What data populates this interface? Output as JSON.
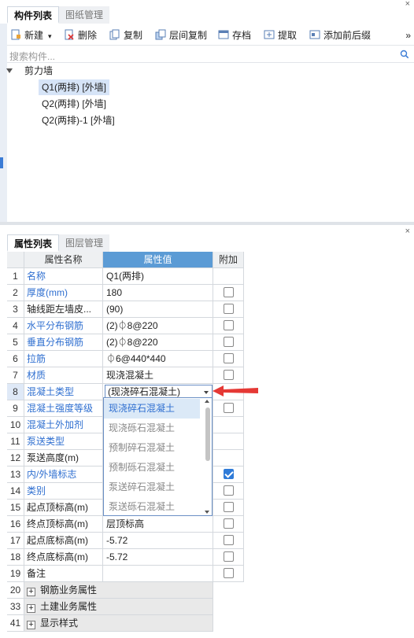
{
  "component_panel": {
    "tabs": [
      "构件列表",
      "图纸管理"
    ],
    "toolbar": [
      {
        "label": "新建",
        "icon": "new-icon"
      },
      {
        "label": "删除",
        "icon": "delete-icon"
      },
      {
        "label": "复制",
        "icon": "copy-icon"
      },
      {
        "label": "层间复制",
        "icon": "floor-copy-icon"
      },
      {
        "label": "存档",
        "icon": "archive-icon"
      },
      {
        "label": "提取",
        "icon": "extract-icon"
      },
      {
        "label": "添加前后缀",
        "icon": "add-prefix-suffix-icon"
      }
    ],
    "more": "»",
    "search_placeholder": "搜索构件...",
    "tree": {
      "root": "剪力墙",
      "items": [
        "Q1(两排) [外墙]",
        "Q2(两排) [外墙]",
        "Q2(两排)-1 [外墙]"
      ],
      "selected_index": 0
    }
  },
  "property_panel": {
    "tabs": [
      "属性列表",
      "图层管理"
    ],
    "headers": {
      "name": "属性名称",
      "value": "属性值",
      "add": "附加"
    },
    "rows": [
      {
        "idx": "1",
        "name": "名称",
        "value": "Q1(两排)",
        "checkbox": null
      },
      {
        "idx": "2",
        "name": "厚度(mm)",
        "value": "180",
        "checkbox": false
      },
      {
        "idx": "3",
        "name": "轴线距左墙皮...",
        "value": "(90)",
        "checkbox": false
      },
      {
        "idx": "4",
        "name": "水平分布钢筋",
        "value": "(2)⏀8@220",
        "checkbox": false
      },
      {
        "idx": "5",
        "name": "垂直分布钢筋",
        "value": "(2)⏀8@220",
        "checkbox": false
      },
      {
        "idx": "6",
        "name": "拉筋",
        "value": "⏀6@440*440",
        "checkbox": false
      },
      {
        "idx": "7",
        "name": "材质",
        "value": "现浇混凝土",
        "checkbox": false
      },
      {
        "idx": "8",
        "name": "混凝土类型",
        "value": "(现浇碎石混凝土)",
        "checkbox": null
      },
      {
        "idx": "9",
        "name": "混凝土强度等级",
        "value": "",
        "checkbox": false
      },
      {
        "idx": "10",
        "name": "混凝土外加剂",
        "value": "",
        "checkbox": null
      },
      {
        "idx": "11",
        "name": "泵送类型",
        "value": "",
        "checkbox": null
      },
      {
        "idx": "12",
        "name": "泵送高度(m)",
        "value": "",
        "checkbox": null
      },
      {
        "idx": "13",
        "name": "内/外墙标志",
        "value": "",
        "checkbox": true
      },
      {
        "idx": "14",
        "name": "类别",
        "value": "",
        "checkbox": false
      },
      {
        "idx": "15",
        "name": "起点顶标高(m)",
        "value": "",
        "checkbox": false
      },
      {
        "idx": "16",
        "name": "终点顶标高(m)",
        "value": "层顶标高",
        "checkbox": false
      },
      {
        "idx": "17",
        "name": "起点底标高(m)",
        "value": "-5.72",
        "checkbox": false
      },
      {
        "idx": "18",
        "name": "终点底标高(m)",
        "value": "-5.72",
        "checkbox": false
      },
      {
        "idx": "19",
        "name": "备注",
        "value": "",
        "checkbox": false
      }
    ],
    "groups": [
      {
        "idx": "20",
        "label": "钢筋业务属性"
      },
      {
        "idx": "33",
        "label": "土建业务属性"
      },
      {
        "idx": "41",
        "label": "显示样式"
      }
    ],
    "dropdown": {
      "options": [
        "现浇碎石混凝土",
        "现浇砾石混凝土",
        "预制碎石混凝土",
        "预制砾石混凝土",
        "泵送碎石混凝土",
        "泵送砾石混凝土"
      ],
      "highlighted_index": 0
    },
    "accent_color": "#5b9bd5",
    "pointer_color": "#e53935"
  }
}
